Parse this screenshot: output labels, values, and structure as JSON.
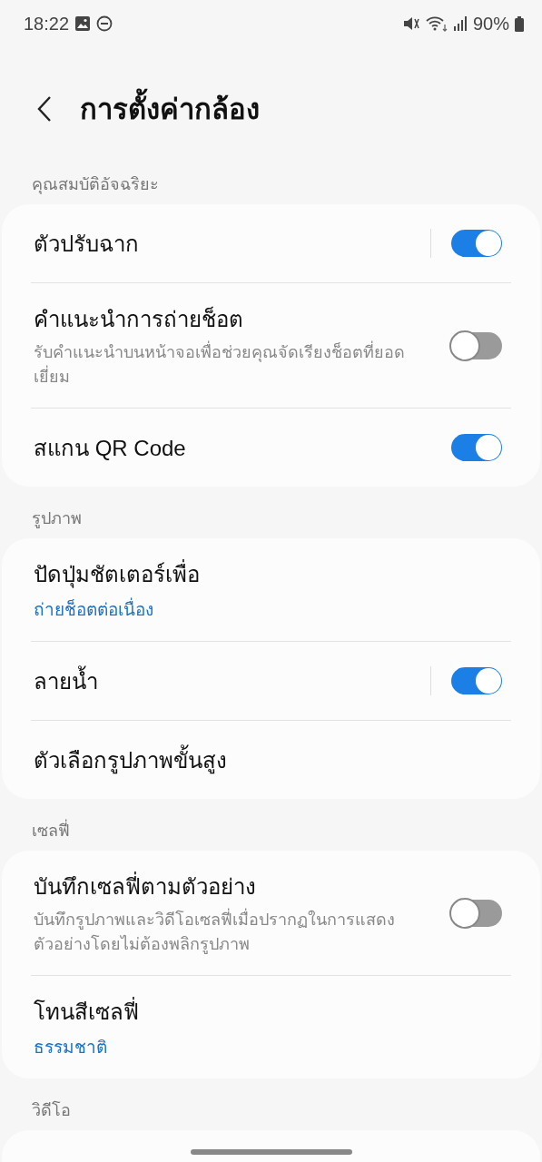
{
  "status_bar": {
    "time": "18:22",
    "battery": "90%"
  },
  "header": {
    "title": "การตั้งค่ากล้อง"
  },
  "sections": [
    {
      "title": "คุณสมบัติอัจฉริยะ",
      "items": [
        {
          "kind": "toggle",
          "label": "ตัวปรับฉาก",
          "on": true,
          "separator": true
        },
        {
          "kind": "toggle",
          "label": "คำแนะนำการถ่ายช็อต",
          "description": "รับคำแนะนำบนหน้าจอเพื่อช่วยคุณจัดเรียงช็อตที่ยอดเยี่ยม",
          "on": false,
          "separator": false
        },
        {
          "kind": "toggle",
          "label": "สแกน QR Code",
          "on": true,
          "separator": false
        }
      ]
    },
    {
      "title": "รูปภาพ",
      "items": [
        {
          "kind": "link",
          "label": "ปัดปุ่มชัตเตอร์เพื่อ",
          "value": "ถ่ายช็อตต่อเนื่อง"
        },
        {
          "kind": "toggle",
          "label": "ลายน้ำ",
          "on": true,
          "separator": true
        },
        {
          "kind": "link",
          "label": "ตัวเลือกรูปภาพขั้นสูง"
        }
      ]
    },
    {
      "title": "เซลฟี่",
      "items": [
        {
          "kind": "toggle",
          "label": "บันทึกเซลฟี่ตามตัวอย่าง",
          "description": "บันทึกรูปภาพและวิดีโอเซลฟี่เมื่อปรากฏในการแสดงตัวอย่างโดยไม่ต้องพลิกรูปภาพ",
          "on": false,
          "separator": false
        },
        {
          "kind": "link",
          "label": "โทนสีเซลฟี่",
          "value": "ธรรมชาติ"
        }
      ]
    },
    {
      "title": "วิดีโอ"
    }
  ]
}
